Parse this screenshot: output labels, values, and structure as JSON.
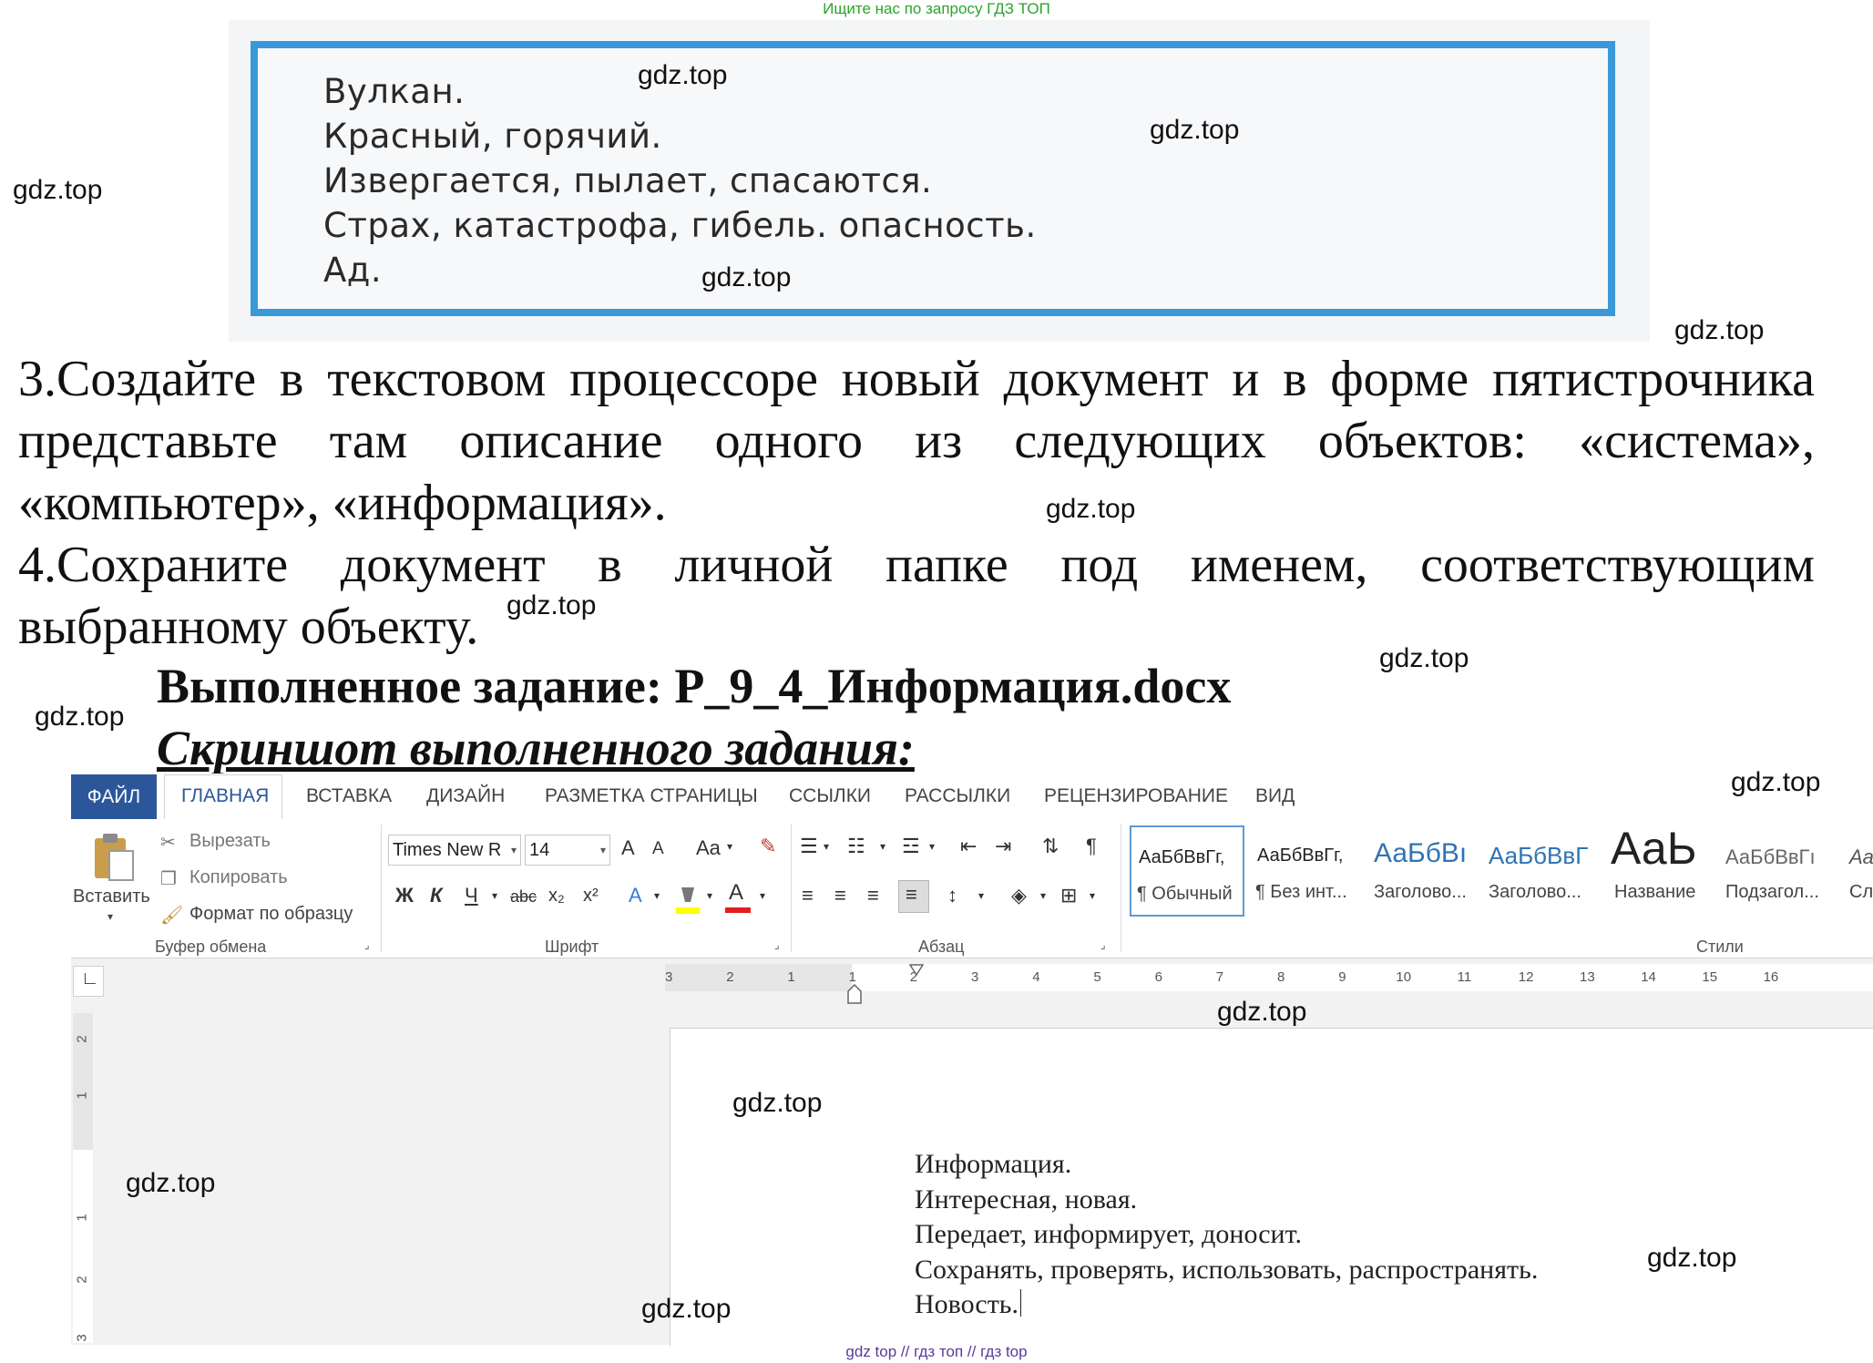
{
  "top_note": "Ищите нас по запросу ГДЗ ТОП",
  "bottom_note": "gdz top  //  гдз топ  //  гдз top",
  "watermark": "gdz.top",
  "scan": {
    "lines": [
      "Вулкан.",
      "Красный, горячий.",
      "Извергается, пылает, спасаются.",
      "Страх, катастрофа, гибель. опасность.",
      "Ад."
    ]
  },
  "task3": "3.Создайте в текстовом процессоре новый документ и в форме пятистрочника представьте там описание одного из следующих объектов: «система», «компьютер», «информация».",
  "task4": "4.Сохраните документ в личной папке под именем, соответствующим выбранному объекту.",
  "heading": "Выполненное задание: Р_9_4_Информация.docx",
  "subheading": "Скриншот выполненного задания:",
  "word": {
    "tabs": [
      "ФАЙЛ",
      "ГЛАВНАЯ",
      "ВСТАВКА",
      "ДИЗАЙН",
      "РАЗМЕТКА СТРАНИЦЫ",
      "ССЫЛКИ",
      "РАССЫЛКИ",
      "РЕЦЕНЗИРОВАНИЕ",
      "ВИД"
    ],
    "clipboard": {
      "paste": "Вставить",
      "cut": "Вырезать",
      "copy": "Копировать",
      "format_painter": "Формат по образцу",
      "label": "Буфер обмена"
    },
    "font": {
      "name": "Times New R",
      "size": "14",
      "label": "Шрифт",
      "case": "Aa",
      "bold": "Ж",
      "italic": "К",
      "underline": "Ч",
      "strike": "abc",
      "sub": "x₂",
      "sup": "x²",
      "grow": "A",
      "shrink": "A",
      "color_letter": "A"
    },
    "paragraph": {
      "label": "Абзац"
    },
    "styles": {
      "label": "Стили",
      "items": [
        {
          "sample": "АаБбВвГг,",
          "name": "¶ Обычный"
        },
        {
          "sample": "АаБбВвГг,",
          "name": "¶ Без инт..."
        },
        {
          "sample": "АаБбВı",
          "name": "Заголово..."
        },
        {
          "sample": "АаБбВвГ",
          "name": "Заголово..."
        },
        {
          "sample": "АаЬ",
          "name": "Название"
        },
        {
          "sample": "АаБбВвГı",
          "name": "Подзагол..."
        },
        {
          "sample": "Аа",
          "name": "Сл"
        }
      ]
    },
    "ruler": {
      "h": [
        "3",
        "2",
        "1",
        "1",
        "2",
        "3",
        "4",
        "5",
        "6",
        "7",
        "8",
        "9",
        "10",
        "11",
        "12",
        "13",
        "14",
        "15",
        "16"
      ],
      "v": [
        "2",
        "1",
        "1",
        "2",
        "3"
      ]
    },
    "document_lines": [
      "Информация.",
      "Интересная, новая.",
      "Передает, информирует, доносит.",
      "Сохранять, проверять, использовать, распространять.",
      "Новость."
    ]
  },
  "colors": {
    "accent_file_tab": "#2b579a",
    "scan_border": "#3a98d8",
    "top_note": "#2aa52a",
    "bottom_note": "#5b3a9a"
  }
}
